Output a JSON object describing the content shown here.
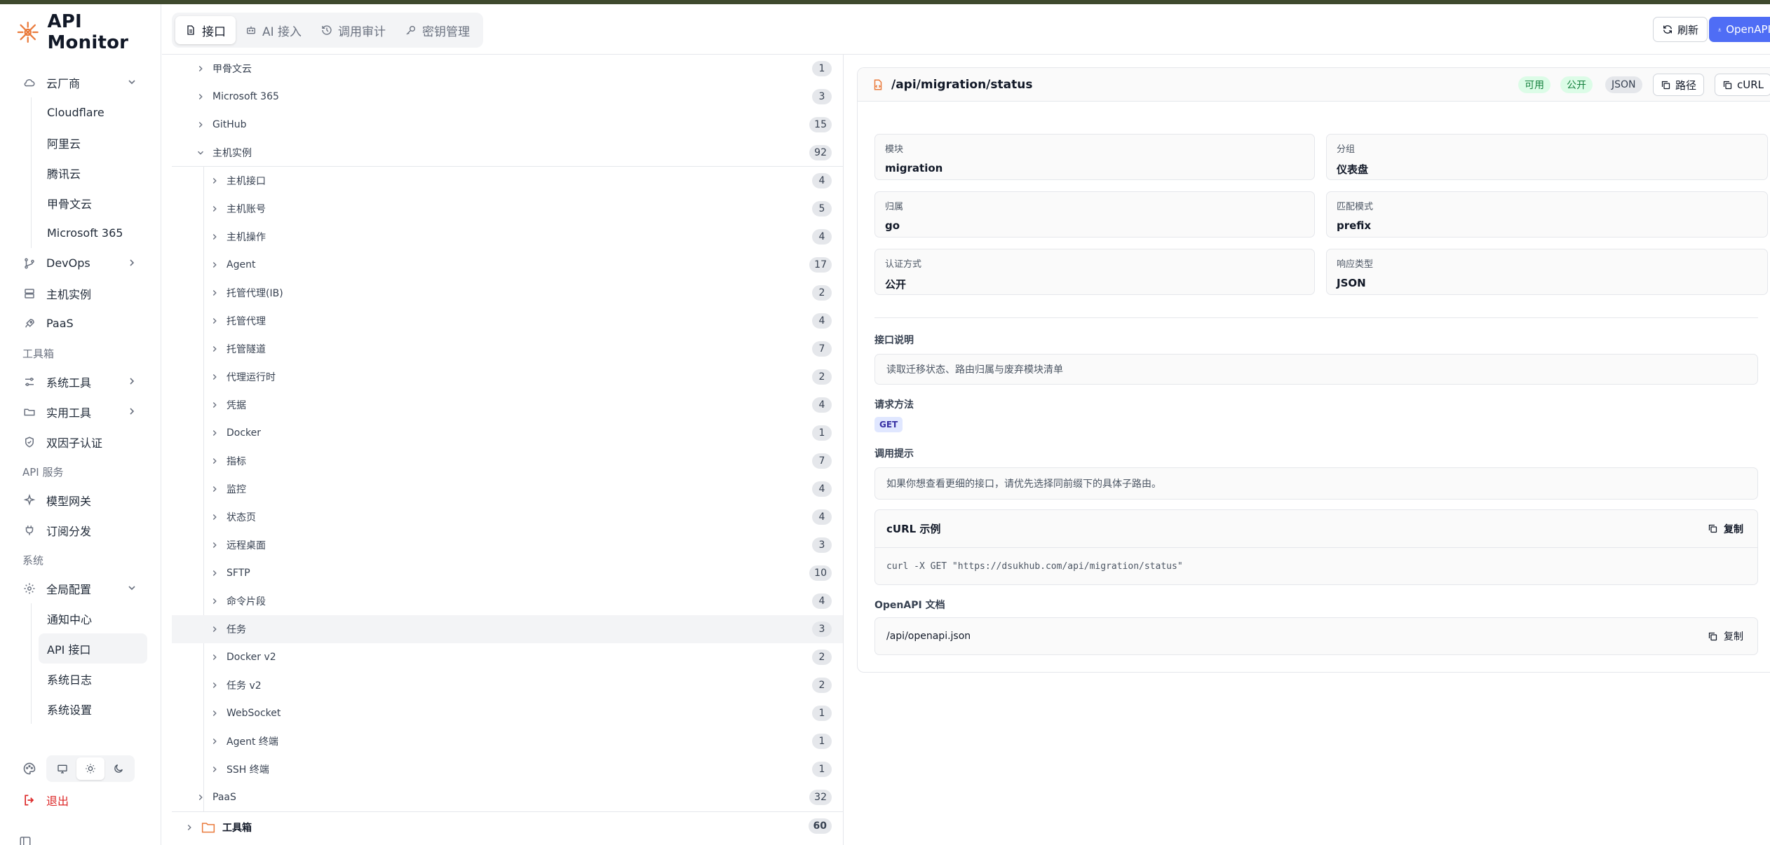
{
  "app": {
    "title": "API Monitor"
  },
  "sidebar": {
    "cloud": {
      "label": "云厂商",
      "items": [
        "Cloudflare",
        "阿里云",
        "腾讯云",
        "甲骨文云",
        "Microsoft 365"
      ]
    },
    "devops": "DevOps",
    "hosts": "主机实例",
    "paas": "PaaS",
    "group_toolbox": "工具箱",
    "system_tools": "系统工具",
    "utility_tools": "实用工具",
    "two_factor": "双因子认证",
    "group_api": "API 服务",
    "model_gateway": "模型网关",
    "subscription": "订阅分发",
    "group_system": "系统",
    "global_config": {
      "label": "全局配置",
      "items": [
        "通知中心",
        "API 接口",
        "系统日志",
        "系统设置"
      ]
    },
    "logout": "退出"
  },
  "header": {
    "tabs": [
      {
        "label": "接口",
        "icon": "file-icon"
      },
      {
        "label": "AI 接入",
        "icon": "robot-icon"
      },
      {
        "label": "调用审计",
        "icon": "history-icon"
      },
      {
        "label": "密钥管理",
        "icon": "key-icon"
      }
    ],
    "refresh": "刷新",
    "openapi": "OpenAPI"
  },
  "tree": {
    "l1_before": [
      {
        "label": "甲骨文云",
        "count": "1"
      },
      {
        "label": "Microsoft 365",
        "count": "3"
      },
      {
        "label": "GitHub",
        "count": "15"
      },
      {
        "label": "主机实例",
        "count": "92"
      }
    ],
    "l2": [
      {
        "label": "主机接口",
        "count": "4"
      },
      {
        "label": "主机账号",
        "count": "5"
      },
      {
        "label": "主机操作",
        "count": "4"
      },
      {
        "label": "Agent",
        "count": "17"
      },
      {
        "label": "托管代理(IB)",
        "count": "2"
      },
      {
        "label": "托管代理",
        "count": "4"
      },
      {
        "label": "托管隧道",
        "count": "7"
      },
      {
        "label": "代理运行时",
        "count": "2"
      },
      {
        "label": "凭据",
        "count": "4"
      },
      {
        "label": "Docker",
        "count": "1"
      },
      {
        "label": "指标",
        "count": "7"
      },
      {
        "label": "监控",
        "count": "4"
      },
      {
        "label": "状态页",
        "count": "4"
      },
      {
        "label": "远程桌面",
        "count": "3"
      },
      {
        "label": "SFTP",
        "count": "10"
      },
      {
        "label": "命令片段",
        "count": "4"
      },
      {
        "label": "任务",
        "count": "3"
      },
      {
        "label": "Docker v2",
        "count": "2"
      },
      {
        "label": "任务 v2",
        "count": "2"
      },
      {
        "label": "WebSocket",
        "count": "1"
      },
      {
        "label": "Agent 终端",
        "count": "1"
      },
      {
        "label": "SSH 终端",
        "count": "1"
      }
    ],
    "l1_after": {
      "label": "PaaS",
      "count": "32"
    },
    "top": {
      "label": "工具箱",
      "count": "60"
    }
  },
  "detail": {
    "path": "/api/migration/status",
    "badges": {
      "avail": "可用",
      "public": "公开",
      "json": "JSON"
    },
    "btn_path": "路径",
    "btn_curl": "cURL",
    "fields": [
      {
        "label": "模块",
        "value": "migration"
      },
      {
        "label": "分组",
        "value": "仪表盘"
      },
      {
        "label": "归属",
        "value": "go"
      },
      {
        "label": "匹配模式",
        "value": "prefix"
      },
      {
        "label": "认证方式",
        "value": "公开"
      },
      {
        "label": "响应类型",
        "value": "JSON"
      }
    ],
    "desc_title": "接口说明",
    "desc": "读取迁移状态、路由归属与废弃模块清单",
    "method_title": "请求方法",
    "method": "GET",
    "hint_title": "调用提示",
    "hint": "如果你想查看更细的接口，请优先选择同前缀下的具体子路由。",
    "curl_title": "cURL 示例",
    "copy": "复制",
    "curl_cmd": "curl -X GET \"https://dsukhub.com/api/migration/status\"",
    "openapi_title": "OpenAPI 文档",
    "openapi_path": "/api/openapi.json"
  },
  "colors": {
    "accent": "#4f6df5",
    "brand": "#ea7a3b",
    "success": "#15803d",
    "danger": "#dc2626"
  }
}
